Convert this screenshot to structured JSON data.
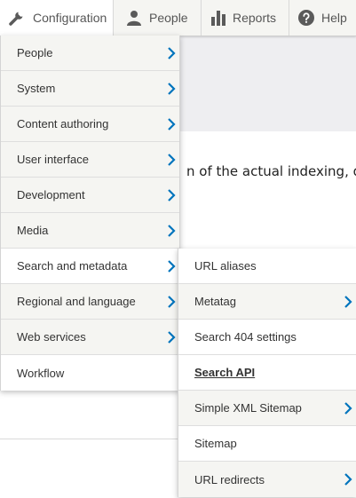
{
  "toolbar": {
    "configuration": "Configuration",
    "people": "People",
    "reports": "Reports",
    "help": "Help"
  },
  "background": {
    "partial_text": "n of the actual indexing, que"
  },
  "config_menu": {
    "items": [
      {
        "label": "People",
        "has_submenu": true
      },
      {
        "label": "System",
        "has_submenu": true
      },
      {
        "label": "Content authoring",
        "has_submenu": true
      },
      {
        "label": "User interface",
        "has_submenu": true
      },
      {
        "label": "Development",
        "has_submenu": true
      },
      {
        "label": "Media",
        "has_submenu": true
      },
      {
        "label": "Search and metadata",
        "has_submenu": true
      },
      {
        "label": "Regional and language",
        "has_submenu": true
      },
      {
        "label": "Web services",
        "has_submenu": true
      },
      {
        "label": "Workflow",
        "has_submenu": false
      }
    ]
  },
  "search_menu": {
    "items": [
      {
        "label": "URL aliases",
        "has_submenu": false
      },
      {
        "label": "Metatag",
        "has_submenu": true
      },
      {
        "label": "Search 404 settings",
        "has_submenu": false
      },
      {
        "label": "Search API",
        "has_submenu": false,
        "active": true
      },
      {
        "label": "Simple XML Sitemap",
        "has_submenu": true
      },
      {
        "label": "Sitemap",
        "has_submenu": false
      },
      {
        "label": "URL redirects",
        "has_submenu": true
      }
    ]
  },
  "colors": {
    "chevron": "#0074bd",
    "toolbar_icon": "#5a5a5a"
  },
  "icons": {
    "configuration": "wrench-icon",
    "people": "person-icon",
    "reports": "bar-chart-icon",
    "help": "question-circle-icon",
    "submenu": "chevron-right-icon"
  }
}
